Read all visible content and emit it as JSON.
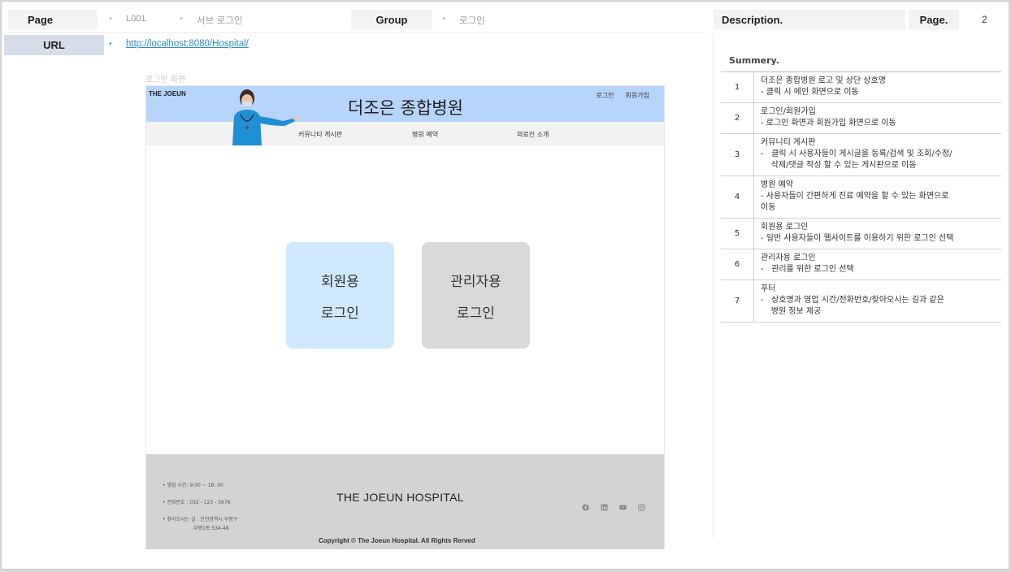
{
  "header": {
    "page_label": "Page",
    "page_id": "L001",
    "page_name": "서브 로그인",
    "group_label": "Group",
    "group_value": "로그인",
    "description_label": "Description.",
    "page_dot_label": "Page.",
    "page_number": "2",
    "url_label": "URL",
    "url_value": "http://localhost:8080/Hospital/"
  },
  "screen_caption": "로그인 화면",
  "site": {
    "brand": "THE JOEUN",
    "title": "더조은 종합병원",
    "top_links": {
      "login": "로그인",
      "signup": "회원가입"
    },
    "nav": {
      "community": "커뮤니티 게시판",
      "reservation": "병원 예약",
      "staff": "의료진 소개"
    },
    "member_login": {
      "line1": "회원용",
      "line2": "로그인"
    },
    "admin_login": {
      "line1": "관리자용",
      "line2": "로그인"
    },
    "footer": {
      "hours": "• 영업 시간: 9:00 ~ 18: 00",
      "phone": "• 전화번호 : 032 - 123 - 5678",
      "address1": "• 찾아오시는 길 : 인천광역시 부평구",
      "address2": "부평1동 534-48",
      "name": "THE JOEUN HOSPITAL",
      "copyright": "Copyright © The Joeun Hospital. All Rights Rerved"
    },
    "social_icons": [
      "facebook-icon",
      "linkedin-icon",
      "youtube-icon",
      "instagram-icon"
    ]
  },
  "summary": {
    "title": "Summery.",
    "rows": [
      {
        "num": "1",
        "lines": [
          "더조은 종합병원 로고 및 상단 상호명",
          "- 클릭 시 메인 화면으로 이동"
        ]
      },
      {
        "num": "2",
        "lines": [
          "로그인/회원가입",
          "- 로그인 화면과 회원가입 화면으로 이동"
        ]
      },
      {
        "num": "3",
        "lines": [
          "커뮤니티 게시판",
          "-   클릭 시 사용자들이 게시글을 등록/검색 및 조회/수정/",
          "    삭제/댓글 작성 할 수 있는 게시판으로 이동"
        ]
      },
      {
        "num": "4",
        "lines": [
          "병원 예약",
          "- 사용자들이 간편하게 진료 예약을 할 수 있는 화면으로",
          "이동"
        ]
      },
      {
        "num": "5",
        "lines": [
          "회원용 로그인",
          "- 일반 사용자들이 웹사이트를 이용하기 위한 로그인 선택"
        ]
      },
      {
        "num": "6",
        "lines": [
          "관리자용 로그인",
          "-   관리를 위한 로그인 선택"
        ]
      },
      {
        "num": "7",
        "lines": [
          "푸터",
          "-   상호명과 영업 시간/전화번호/찾아오시는 길과 같은",
          "    병원 정보 제공"
        ]
      }
    ]
  }
}
